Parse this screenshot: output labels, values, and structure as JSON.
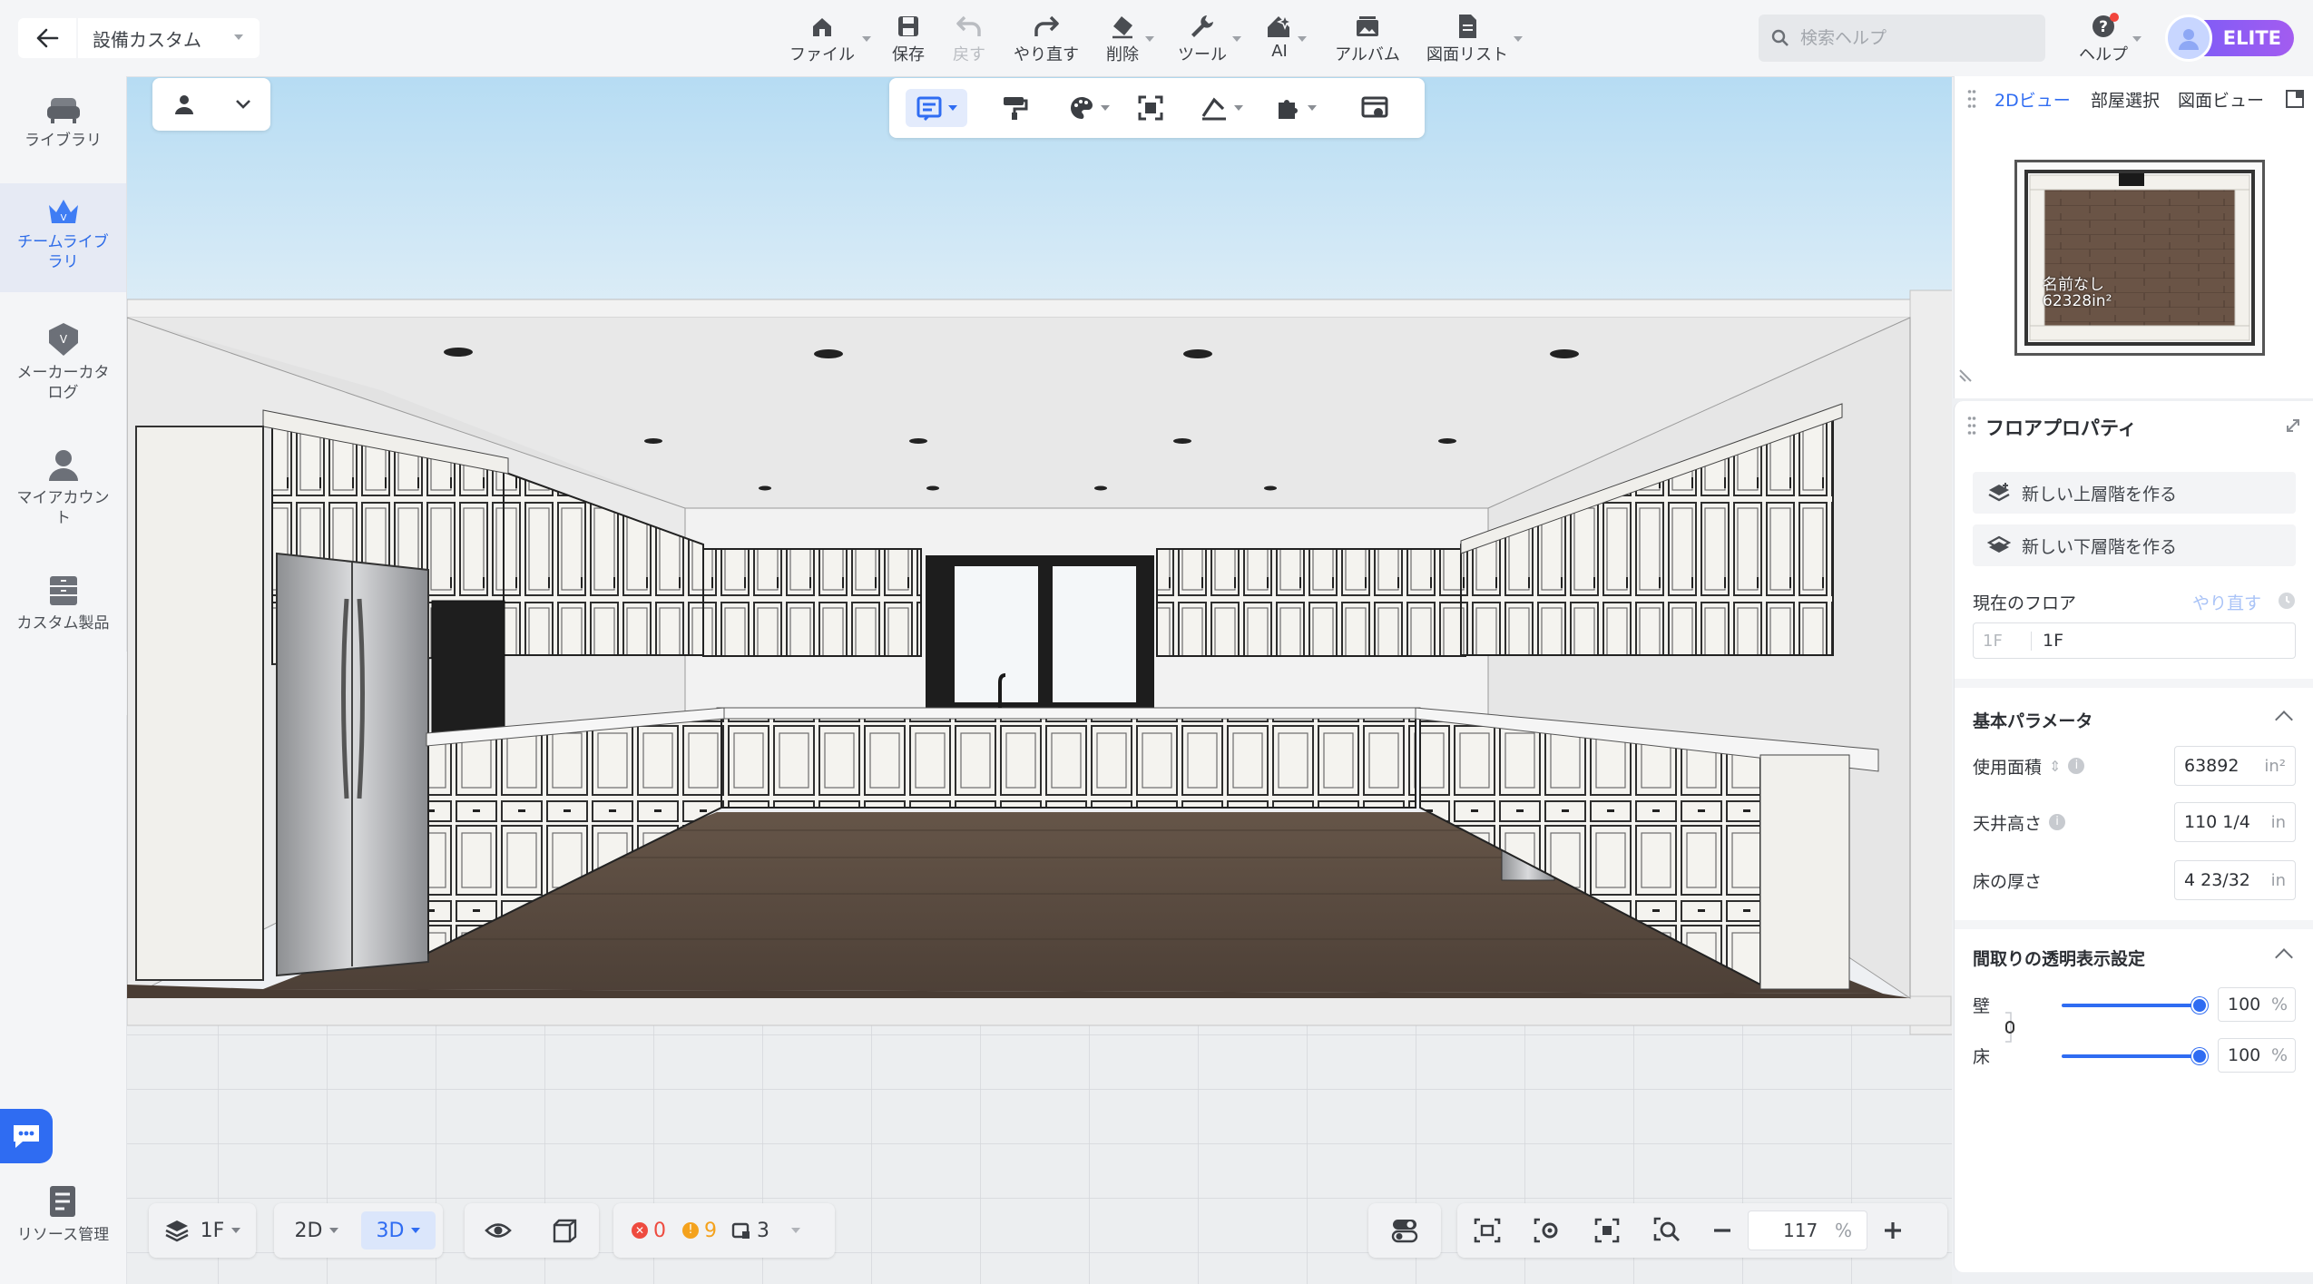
{
  "header": {
    "project_name": "設備カスタム",
    "toolbar": [
      {
        "id": "file",
        "label": "ファイル",
        "dropdown": true
      },
      {
        "id": "save",
        "label": "保存",
        "dropdown": false
      },
      {
        "id": "undo",
        "label": "戻す",
        "dropdown": false,
        "disabled": true
      },
      {
        "id": "redo",
        "label": "やり直す",
        "dropdown": false
      },
      {
        "id": "delete",
        "label": "削除",
        "dropdown": true
      },
      {
        "id": "tools",
        "label": "ツール",
        "dropdown": true
      },
      {
        "id": "ai",
        "label": "AI",
        "dropdown": true
      },
      {
        "id": "album",
        "label": "アルバム",
        "dropdown": false
      },
      {
        "id": "drawing_list",
        "label": "図面リスト",
        "dropdown": true
      }
    ],
    "search_placeholder": "検索ヘルプ",
    "help_label": "ヘルプ",
    "badge": "ELITE"
  },
  "sidebar": {
    "items": [
      {
        "label": "ライブラリ",
        "icon": "sofa-icon"
      },
      {
        "label": "チームライブラリ",
        "icon": "crown-icon",
        "active": true
      },
      {
        "label": "メーカーカタログ",
        "icon": "badge-icon"
      },
      {
        "label": "マイアカウント",
        "icon": "user-icon"
      },
      {
        "label": "カスタム製品",
        "icon": "cabinet-icon"
      }
    ],
    "bottom_label": "リソース管理"
  },
  "right_panel": {
    "tabs": [
      "2Dビュー",
      "部屋選択",
      "図面ビュー"
    ],
    "active_tab": "2Dビュー",
    "minimap": {
      "room_name": "名前なし",
      "area": "62328in²"
    },
    "properties": {
      "title": "フロアプロパティ",
      "create_upper": "新しい上層階を作る",
      "create_lower": "新しい下層階を作る",
      "current_floor_label": "現在のフロア",
      "current_floor_action": "やり直す",
      "floor_prefix": "1F",
      "floor_value": "1F",
      "basic_params_title": "基本パラメータ",
      "params": [
        {
          "label": "使用面積",
          "value": "63892",
          "unit": "in²",
          "info": true,
          "sort": true
        },
        {
          "label": "天井高さ",
          "value": "110 1/4",
          "unit": "in",
          "info": true
        },
        {
          "label": "床の厚さ",
          "value": "4 23/32",
          "unit": "in",
          "info": false
        }
      ],
      "transparency_title": "間取りの透明表示設定",
      "transparency": [
        {
          "label": "壁",
          "value": "100",
          "unit": "%",
          "level": 1.0
        },
        {
          "label": "床",
          "value": "100",
          "unit": "%",
          "level": 1.0
        }
      ]
    }
  },
  "bottom_bar": {
    "floor": "1F",
    "view_2d": "2D",
    "view_3d": "3D",
    "errors": "0",
    "warnings": "9",
    "items": "3",
    "zoom": "117",
    "zoom_unit": "%"
  },
  "colors": {
    "accent": "#2f6cf2",
    "elite_gradient_start": "#7b5cf7",
    "elite_gradient_end": "#a35cf0",
    "floor_wood": "#5b4d42",
    "sky": "#cfe6f5"
  }
}
